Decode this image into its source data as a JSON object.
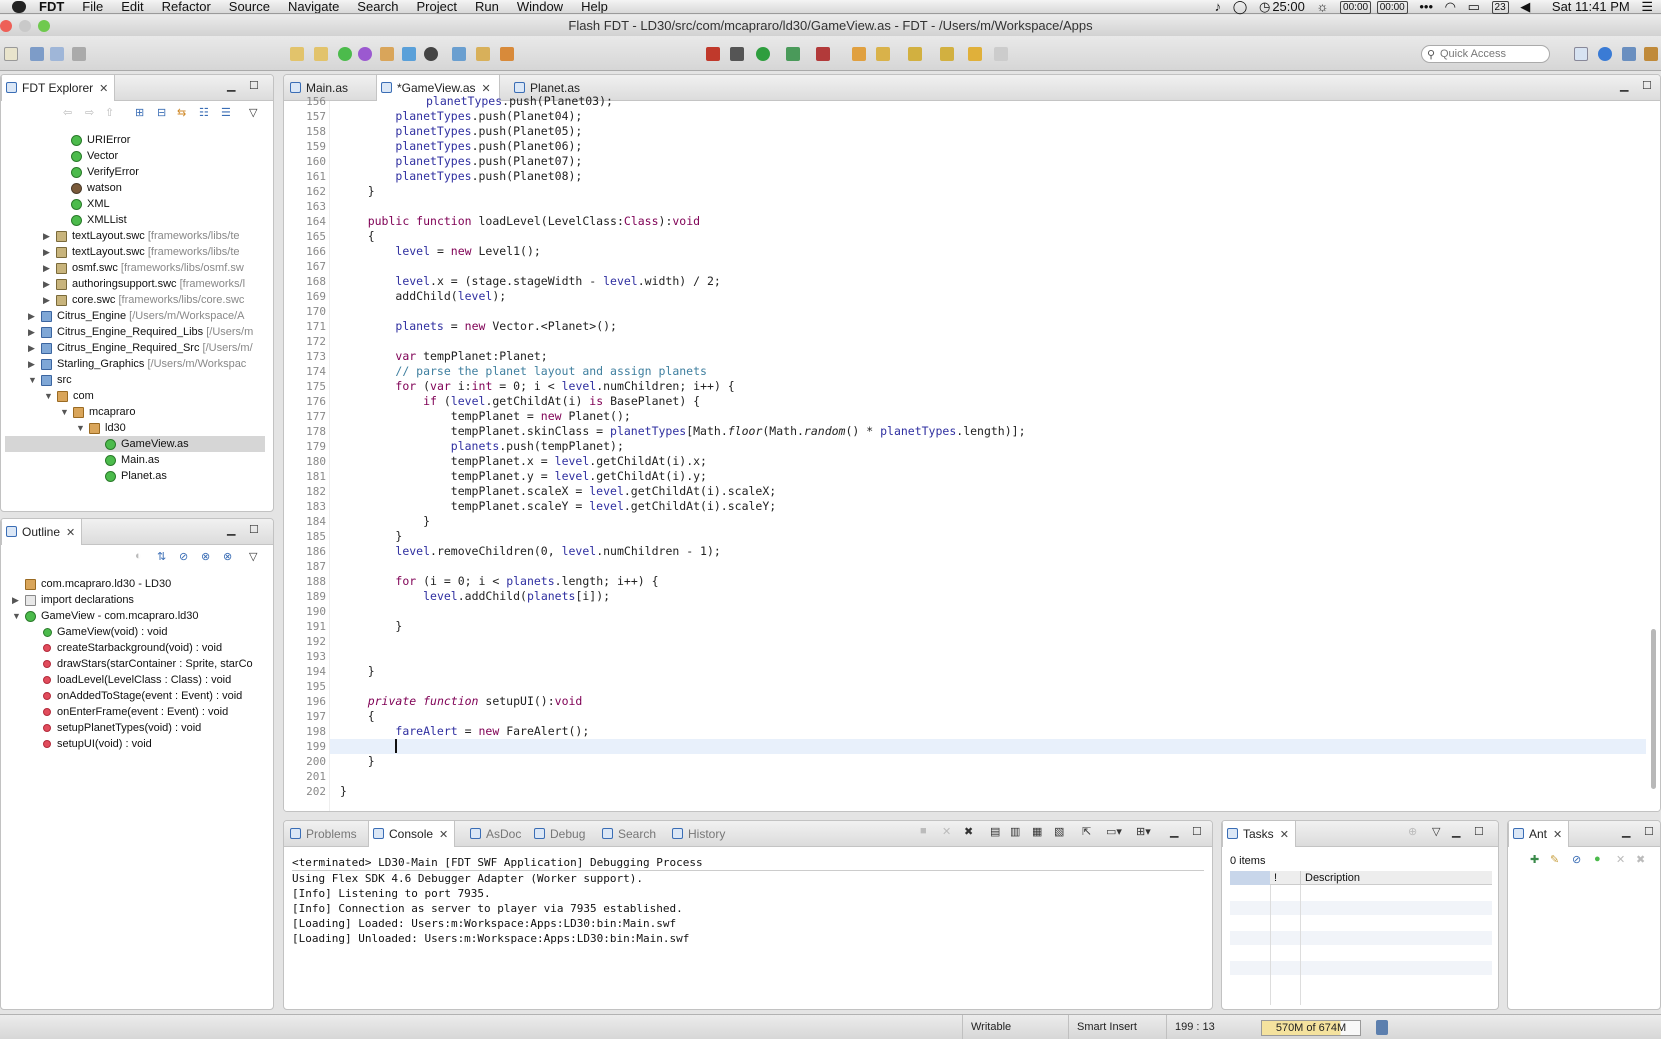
{
  "menubar": {
    "app": "FDT",
    "items": [
      "File",
      "Edit",
      "Refactor",
      "Source",
      "Navigate",
      "Search",
      "Project",
      "Run",
      "Window",
      "Help"
    ],
    "timer": "25:00",
    "box1": "00:00",
    "box2": "00:00",
    "calendar": "23",
    "clock": "Sat 11:41 PM"
  },
  "window": {
    "title": "Flash FDT - LD30/src/com/mcapraro/ld30/GameView.as - FDT - /Users/m/Workspace/Apps"
  },
  "toolbar": {
    "quick_access_placeholder": "Quick Access"
  },
  "explorer": {
    "tab": "FDT Explorer",
    "rows": [
      {
        "label": "URIError",
        "path": ""
      },
      {
        "label": "Vector",
        "path": ""
      },
      {
        "label": "VerifyError",
        "path": ""
      },
      {
        "label": "watson",
        "path": ""
      },
      {
        "label": "XML",
        "path": ""
      },
      {
        "label": "XMLList",
        "path": ""
      },
      {
        "label": "textLayout.swc",
        "path": "[frameworks/libs/te"
      },
      {
        "label": "textLayout.swc",
        "path": "[frameworks/libs/te"
      },
      {
        "label": "osmf.swc",
        "path": "[frameworks/libs/osmf.sw"
      },
      {
        "label": "authoringsupport.swc",
        "path": "[frameworks/l"
      },
      {
        "label": "core.swc",
        "path": "[frameworks/libs/core.swc"
      },
      {
        "label": "Citrus_Engine",
        "path": "[/Users/m/Workspace/A"
      },
      {
        "label": "Citrus_Engine_Required_Libs",
        "path": "[/Users/m"
      },
      {
        "label": "Citrus_Engine_Required_Src",
        "path": "[/Users/m/"
      },
      {
        "label": "Starling_Graphics",
        "path": "[/Users/m/Workspac"
      },
      {
        "label": "src",
        "path": ""
      },
      {
        "label": "com",
        "path": ""
      },
      {
        "label": "mcapraro",
        "path": ""
      },
      {
        "label": "ld30",
        "path": ""
      },
      {
        "label": "GameView.as",
        "path": ""
      },
      {
        "label": "Main.as",
        "path": ""
      },
      {
        "label": "Planet.as",
        "path": ""
      }
    ]
  },
  "outline": {
    "tab": "Outline",
    "rows": [
      "com.mcapraro.ld30 - LD30",
      "import declarations",
      "GameView - com.mcapraro.ld30",
      "GameView(void) : void",
      "createStarbackground(void) : void",
      "drawStars(starContainer : Sprite, starCo",
      "loadLevel(LevelClass : Class) : void",
      "onAddedToStage(event : Event) : void",
      "onEnterFrame(event : Event) : void",
      "setupPlanetTypes(void) : void",
      "setupUI(void) : void"
    ]
  },
  "editor": {
    "tabs": [
      "Main.as",
      "*GameView.as",
      "Planet.as"
    ],
    "line_numbers": [
      "156",
      "157",
      "158",
      "159",
      "160",
      "161",
      "162",
      "163",
      "164",
      "165",
      "166",
      "167",
      "168",
      "169",
      "170",
      "171",
      "172",
      "173",
      "174",
      "175",
      "176",
      "177",
      "178",
      "179",
      "180",
      "181",
      "182",
      "183",
      "184",
      "185",
      "186",
      "187",
      "188",
      "189",
      "190",
      "191",
      "192",
      "193",
      "194",
      "195",
      "196",
      "197",
      "198",
      "199",
      "200",
      "201",
      "202"
    ]
  },
  "bottom": {
    "tabs": [
      "Problems",
      "Console",
      "AsDoc",
      "Debug",
      "Search",
      "History"
    ],
    "console_lines": [
      "<terminated> LD30-Main [FDT SWF Application] Debugging Process",
      "Using Flex SDK 4.6 Debugger Adapter (Worker support).",
      "[Info] Listening to port 7935.",
      "[Info] Connection as server to player via 7935 established.",
      "[Loading] Loaded: Users:m:Workspace:Apps:LD30:bin:Main.swf",
      "[Loading] Unloaded: Users:m:Workspace:Apps:LD30:bin:Main.swf"
    ]
  },
  "tasks": {
    "tab": "Tasks",
    "count": "0 items",
    "col_excl": "!",
    "col_desc": "Description"
  },
  "ant": {
    "tab": "Ant"
  },
  "status": {
    "mode": "Writable",
    "insert": "Smart Insert",
    "position": "199 : 13",
    "heap": "570M of 674M"
  }
}
